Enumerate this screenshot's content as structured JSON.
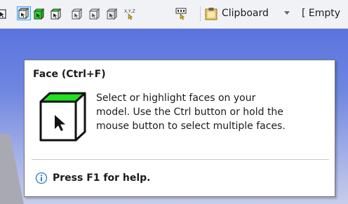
{
  "toolbar": {
    "buttons": [
      {
        "icon": "select-mode-icon",
        "selected": false
      },
      {
        "icon": "face-select-icon",
        "selected": true
      },
      {
        "icon": "body-select-icon",
        "selected": false
      },
      {
        "icon": "edge-select-icon",
        "selected": false
      },
      {
        "icon": "vertex-select-icon",
        "selected": false
      },
      {
        "icon": "element-select-icon",
        "selected": false
      },
      {
        "icon": "coordinate-xyz-icon",
        "selected": false
      },
      {
        "icon": "id-select-icon",
        "selected": false
      }
    ],
    "xyz_text": "X,Y,Z",
    "clipboard_label": "Clipboard",
    "empty_label": "[ Empty"
  },
  "tooltip": {
    "title": "Face (Ctrl+F)",
    "description_lines": [
      "Select or highlight faces on your",
      "model. Use the Ctrl button or hold the",
      "mouse button to select multiple faces."
    ],
    "help_text": "Press F1 for help."
  },
  "colors": {
    "face_green": "#22e022",
    "selected_bg": "#cde8ff",
    "selected_border": "#3fa6ff",
    "viewport_top": "#5a74de",
    "viewport_bottom": "#c7cde9",
    "info_blue": "#2b78c9"
  }
}
